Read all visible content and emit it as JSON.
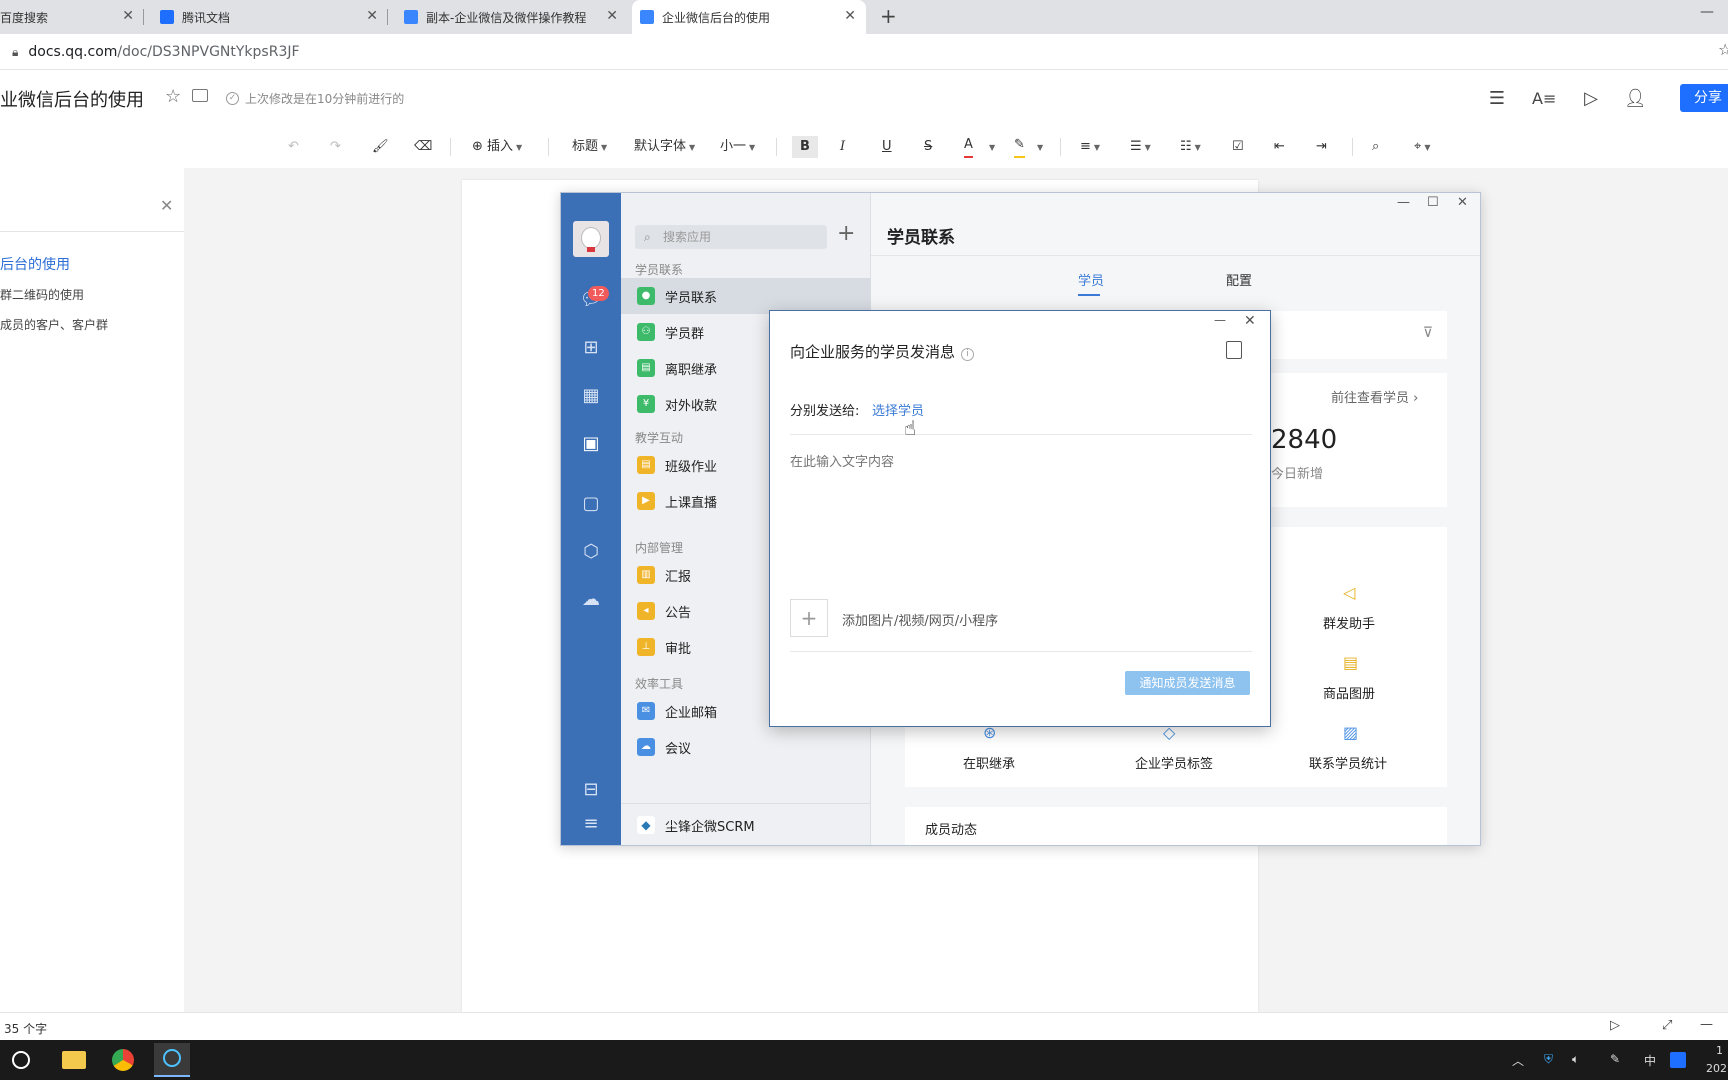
{
  "browser": {
    "tabs": [
      {
        "label": "百度搜索",
        "active": false
      },
      {
        "label": "腾讯文档",
        "active": false
      },
      {
        "label": "副本-企业微信及微伴操作教程",
        "active": false
      },
      {
        "label": "企业微信后台的使用",
        "active": true
      }
    ],
    "new_tab": "+",
    "url_host": "docs.qq.com",
    "url_path": "/doc/DS3NPVGNtYkpsR3JF"
  },
  "doc": {
    "title": "业微信后台的使用",
    "save_status": "上次修改是在10分钟前进行的",
    "share_label": "分享",
    "word_count": "35 个字"
  },
  "toolbar": {
    "insert": "插入",
    "heading": "标题",
    "font": "默认字体",
    "size": "小一"
  },
  "outline": {
    "items": [
      {
        "label": "后台的使用",
        "level": 1
      },
      {
        "label": "群二维码的使用",
        "level": 2
      },
      {
        "label": "成员的客户、客户群",
        "level": 2
      }
    ]
  },
  "wecom": {
    "unread_badge": "12",
    "search_placeholder": "搜索应用",
    "groups": [
      {
        "label": "学员联系",
        "apps": [
          {
            "label": "学员联系",
            "color": "#3dbb6a",
            "selected": true
          },
          {
            "label": "学员群",
            "color": "#3dbb6a"
          },
          {
            "label": "离职继承",
            "color": "#3dbb6a"
          },
          {
            "label": "对外收款",
            "color": "#3dbb6a"
          }
        ]
      },
      {
        "label": "教学互动",
        "apps": [
          {
            "label": "班级作业",
            "color": "#f0b429"
          },
          {
            "label": "上课直播",
            "color": "#f0b429"
          }
        ]
      },
      {
        "label": "内部管理",
        "apps": [
          {
            "label": "汇报",
            "color": "#f0b429"
          },
          {
            "label": "公告",
            "color": "#f0b429"
          },
          {
            "label": "审批",
            "color": "#f0b429"
          }
        ]
      },
      {
        "label": "效率工具",
        "apps": [
          {
            "label": "企业邮箱",
            "color": "#4a90e2"
          },
          {
            "label": "会议",
            "color": "#4a90e2"
          }
        ]
      }
    ],
    "scrm": "尘锋企微SCRM",
    "main": {
      "title": "学员联系",
      "tabs": [
        "学员",
        "配置"
      ],
      "view_students": "前往查看学员",
      "stat_value": "2840",
      "stat_label": "今日新增",
      "tools": [
        "群发助手",
        "商品图册",
        "在职继承",
        "企业学员标签",
        "联系学员统计"
      ],
      "member_activity": "成员动态"
    }
  },
  "dialog": {
    "title": "向企业服务的学员发消息",
    "send_to_label": "分别发送给:",
    "choose_members": "选择学员",
    "input_placeholder": "在此输入文字内容",
    "attach_label": "添加图片/视频/网页/小程序",
    "notify_button": "通知成员发送消息"
  },
  "taskbar": {
    "ime": "中",
    "clock_top": "1",
    "clock_bottom": "202"
  }
}
